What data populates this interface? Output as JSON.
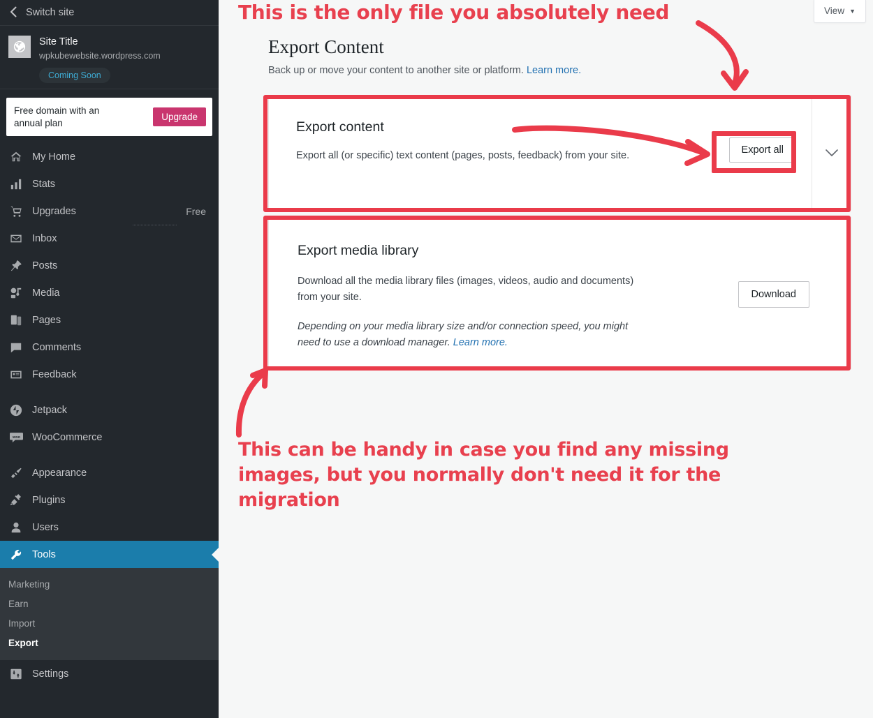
{
  "sidebar": {
    "switch_site_label": "Switch site",
    "site": {
      "title": "Site Title",
      "url": "wpkubewebsite.wordpress.com",
      "badge": "Coming Soon"
    },
    "upgrade_card": {
      "text": "Free domain with an annual plan",
      "button_label": "Upgrade"
    },
    "nav": [
      {
        "label": "My Home",
        "icon": "home-icon",
        "meta": ""
      },
      {
        "label": "Stats",
        "icon": "bar-chart-icon",
        "meta": ""
      },
      {
        "label": "Upgrades",
        "icon": "cart-icon",
        "meta": "Free"
      },
      {
        "label": "Inbox",
        "icon": "envelope-icon",
        "meta": ""
      },
      {
        "label": "Posts",
        "icon": "pin-icon",
        "meta": ""
      },
      {
        "label": "Media",
        "icon": "media-icon",
        "meta": ""
      },
      {
        "label": "Pages",
        "icon": "pages-icon",
        "meta": ""
      },
      {
        "label": "Comments",
        "icon": "comment-icon",
        "meta": ""
      },
      {
        "label": "Feedback",
        "icon": "feedback-icon",
        "meta": ""
      },
      {
        "label": "Jetpack",
        "icon": "jetpack-icon",
        "meta": ""
      },
      {
        "label": "WooCommerce",
        "icon": "woocommerce-icon",
        "meta": ""
      },
      {
        "label": "Appearance",
        "icon": "paintbrush-icon",
        "meta": ""
      },
      {
        "label": "Plugins",
        "icon": "plug-icon",
        "meta": ""
      },
      {
        "label": "Users",
        "icon": "user-icon",
        "meta": ""
      },
      {
        "label": "Tools",
        "icon": "wrench-icon",
        "meta": ""
      }
    ],
    "subnav": [
      {
        "label": "Marketing",
        "current": false
      },
      {
        "label": "Earn",
        "current": false
      },
      {
        "label": "Import",
        "current": false
      },
      {
        "label": "Export",
        "current": true
      }
    ],
    "bottom_nav": [
      {
        "label": "Settings",
        "icon": "sliders-icon"
      }
    ]
  },
  "header": {
    "view_button_label": "View",
    "view_button_caret": "▼"
  },
  "main": {
    "title": "Export Content",
    "subtitle_text": "Back up or move your content to another site or platform.",
    "subtitle_link": "Learn more.",
    "export_card": {
      "heading": "Export content",
      "body": "Export all (or specific) text content (pages, posts, feedback) from your site.",
      "button_label": "Export all"
    },
    "media_card": {
      "heading": "Export media library",
      "body": "Download all the media library files (images, videos, audio and documents) from your site.",
      "note_text": "Depending on your media library size and/or connection speed, you might need to use a download manager.",
      "note_link": "Learn more.",
      "button_label": "Download"
    }
  },
  "annotations": {
    "top_text": "This is the only file you absolutely need",
    "bottom_text": "This can be handy in case you find any missing images, but you normally don't need it for the migration",
    "color": "#ea3b4a"
  },
  "colors": {
    "sidebar_bg": "#23282d",
    "sidebar_subnav_bg": "#32373c",
    "active_nav": "#1b7dab",
    "upgrade_pink": "#c9356e",
    "badge_blue": "#3eacd4",
    "link_blue": "#2271b1",
    "page_bg": "#f6f7f7",
    "annotation_red": "#ea3b4a"
  }
}
